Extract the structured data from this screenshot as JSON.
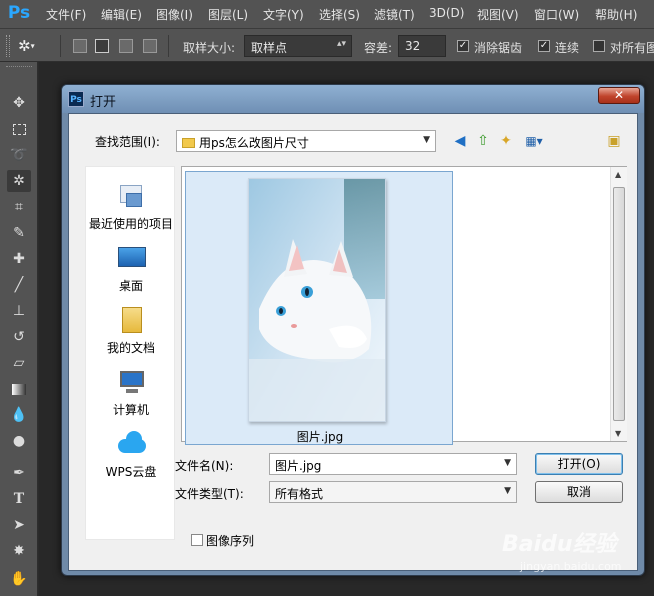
{
  "app": {
    "logo": "Ps",
    "menu": [
      "文件(F)",
      "编辑(E)",
      "图像(I)",
      "图层(L)",
      "文字(Y)",
      "选择(S)",
      "滤镜(T)",
      "3D(D)",
      "视图(V)",
      "窗口(W)",
      "帮助(H)"
    ]
  },
  "options": {
    "sample_size_label": "取样大小:",
    "sample_size_value": "取样点",
    "tolerance_label": "容差:",
    "tolerance_value": "32",
    "antialias_label": "消除锯齿",
    "contiguous_label": "连续",
    "all_layers_label": "对所有图"
  },
  "dialog": {
    "title": "打开",
    "close_symbol": "✕",
    "look_in_label": "查找范围(I):",
    "look_in_value": "用ps怎么改图片尺寸",
    "places": [
      "最近使用的项目",
      "桌面",
      "我的文档",
      "计算机",
      "WPS云盘"
    ],
    "file_item_name": "图片.jpg",
    "filename_label": "文件名(N):",
    "filename_value": "图片.jpg",
    "filetype_label": "文件类型(T):",
    "filetype_value": "所有格式",
    "open_button": "打开(O)",
    "cancel_button": "取消",
    "image_sequence_label": "图像序列"
  },
  "watermark": {
    "brand": "Baidu经验",
    "url": "jingyan.baidu.com"
  }
}
